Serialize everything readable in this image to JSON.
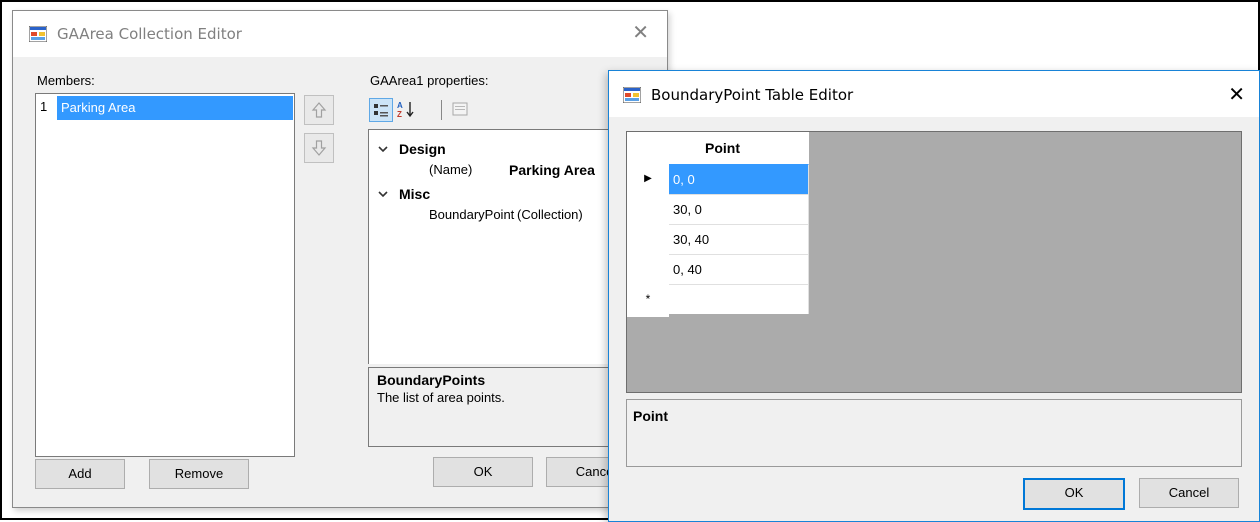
{
  "collection_editor": {
    "title": "GAArea Collection Editor",
    "close_glyph": "✕",
    "members_label": "Members:",
    "members": [
      {
        "index": "1",
        "name": "Parking Area"
      }
    ],
    "properties_label": "GAArea1 properties:",
    "categories": [
      {
        "name": "Design",
        "rows": [
          {
            "name": "(Name)",
            "value": "Parking Area"
          }
        ]
      },
      {
        "name": "Misc",
        "rows": [
          {
            "name": "BoundaryPoint",
            "value": "(Collection)"
          }
        ]
      }
    ],
    "description": {
      "title": "BoundaryPoints",
      "text": "The list of area points."
    },
    "add_label": "Add",
    "remove_label": "Remove",
    "ok_label": "OK",
    "cancel_label": "Cancel"
  },
  "table_editor": {
    "title": "BoundaryPoint Table Editor",
    "close_glyph": "✕",
    "column_header": "Point",
    "rows": [
      "0, 0",
      "30, 0",
      "30, 40",
      "0, 40",
      ""
    ],
    "new_row_marker": "*",
    "current_row_marker": "▶",
    "help_title": "Point",
    "ok_label": "OK",
    "cancel_label": "Cancel"
  },
  "icons": {
    "app": "form-icon",
    "up": "move-up-icon",
    "down": "move-down-icon",
    "categorized": "categorized-icon",
    "alphabetical": "alphabetical-sort-icon",
    "property_pages": "property-pages-icon"
  },
  "colors": {
    "selection": "#3399ff",
    "focus_border": "#0078d7",
    "window_bg": "#f0f0f0",
    "grid_bg": "#ababab"
  }
}
